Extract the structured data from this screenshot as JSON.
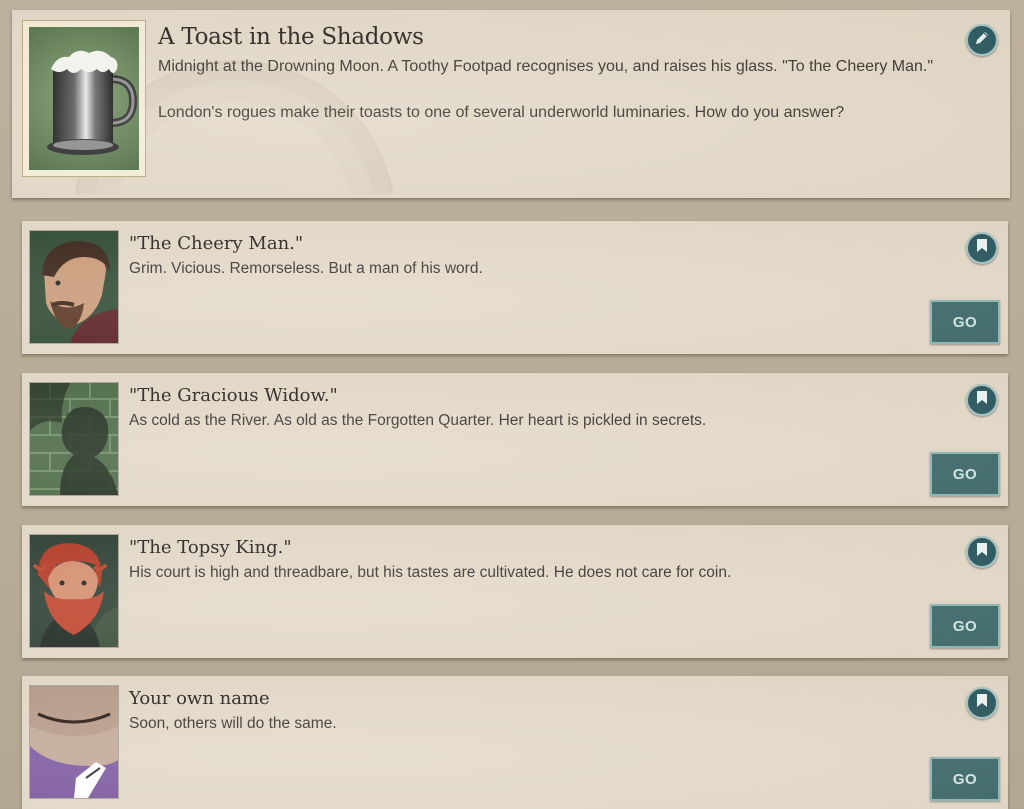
{
  "storylet": {
    "title": "A Toast in the Shadows",
    "description_1": "Midnight at the Drowning Moon. A Toothy Footpad recognises you, and raises his glass. \"To the Cheery Man.\"",
    "description_2": "London's rogues make their toasts to one of several underworld luminaries. How do you answer?",
    "image_icon": "tankard-icon",
    "action_icon": "pencil-icon"
  },
  "branches": [
    {
      "title": "\"The Cheery Man.\"",
      "description": "Grim. Vicious. Remorseless. But a man of his word.",
      "go_label": "GO",
      "portrait": "cheery-man-portrait"
    },
    {
      "title": "\"The Gracious Widow.\"",
      "description": "As cold as the River. As old as the Forgotten Quarter. Her heart is pickled in secrets.",
      "go_label": "GO",
      "portrait": "gracious-widow-portrait"
    },
    {
      "title": "\"The Topsy King.\"",
      "description": "His court is high and threadbare, but his tastes are cultivated. He does not care for coin.",
      "go_label": "GO",
      "portrait": "topsy-king-portrait"
    },
    {
      "title": "Your own name",
      "description": "Soon, others will do the same.",
      "go_label": "GO",
      "portrait": "own-name-portrait"
    }
  ],
  "colors": {
    "card": "#e3d9c8",
    "button": "#3f6a6a",
    "round_button": "#2d5b60"
  }
}
